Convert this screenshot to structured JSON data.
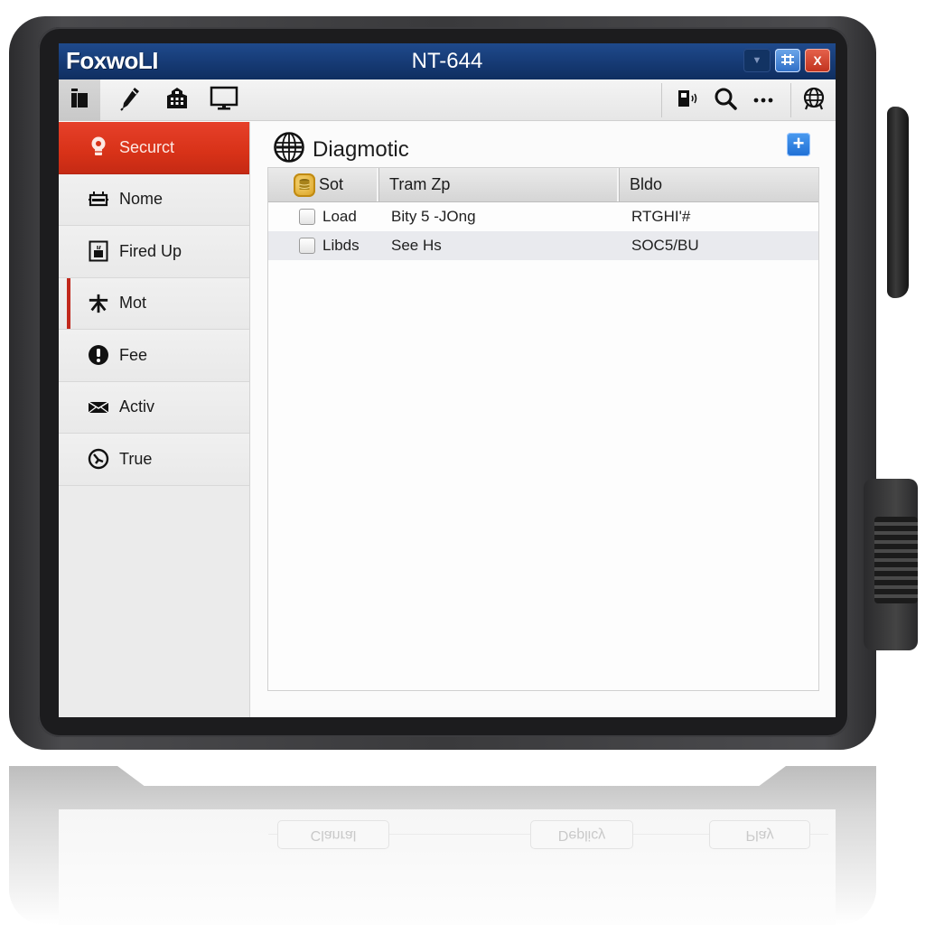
{
  "window": {
    "brand": "FoxwoLI",
    "title": "NT-644",
    "controls": {
      "dropdown_icon": "chevron-down-icon",
      "maximize_icon": "grid-icon",
      "close_icon": "close-icon",
      "close_label": "X",
      "maximize_label": "#"
    }
  },
  "toolbar": {
    "left_tools": [
      {
        "name": "pages",
        "icon": "pages-icon"
      },
      {
        "name": "pen",
        "icon": "pen-icon"
      },
      {
        "name": "building",
        "icon": "building-icon"
      },
      {
        "name": "monitor",
        "icon": "monitor-icon"
      }
    ],
    "right_tools": [
      {
        "name": "fuel-signal",
        "icon": "fuel-signal-icon"
      },
      {
        "name": "search",
        "icon": "search-icon"
      },
      {
        "name": "more",
        "icon": "more-icon",
        "label": "···"
      },
      {
        "name": "globe",
        "icon": "globe-icon"
      }
    ]
  },
  "sidebar": {
    "items": [
      {
        "label": "Securct",
        "icon": "lightbulb-icon",
        "selected": true
      },
      {
        "label": "Nome",
        "icon": "chip-icon"
      },
      {
        "label": "Fired Up",
        "icon": "fire-box-icon"
      },
      {
        "label": "Mot",
        "icon": "star-icon",
        "marked": true
      },
      {
        "label": "Fee",
        "icon": "alert-icon"
      },
      {
        "label": "Activ",
        "icon": "envelope-icon"
      },
      {
        "label": "True",
        "icon": "no-entry-icon"
      }
    ]
  },
  "main": {
    "title": "Diagmotic",
    "title_icon": "globe-icon",
    "add_label": "+",
    "table": {
      "columns": [
        "Sot",
        "Tram Zp",
        "Bldo"
      ],
      "rows": [
        {
          "checked": false,
          "col1": "Load",
          "col2": "Bity 5 -JOng",
          "col3": "RTGHI'#"
        },
        {
          "checked": false,
          "col1": "Libds",
          "col2": "See Hs",
          "col3": "SOC5/BU"
        }
      ]
    },
    "buttons": {
      "left": "Clanral",
      "middle": "Deplicy",
      "right": "Play"
    }
  },
  "colors": {
    "titlebar": "#163a74",
    "selected_item": "#d83218",
    "accent_marker": "#c1281c",
    "add_button": "#1f6fd4",
    "bezel": "#2b2b2d"
  }
}
